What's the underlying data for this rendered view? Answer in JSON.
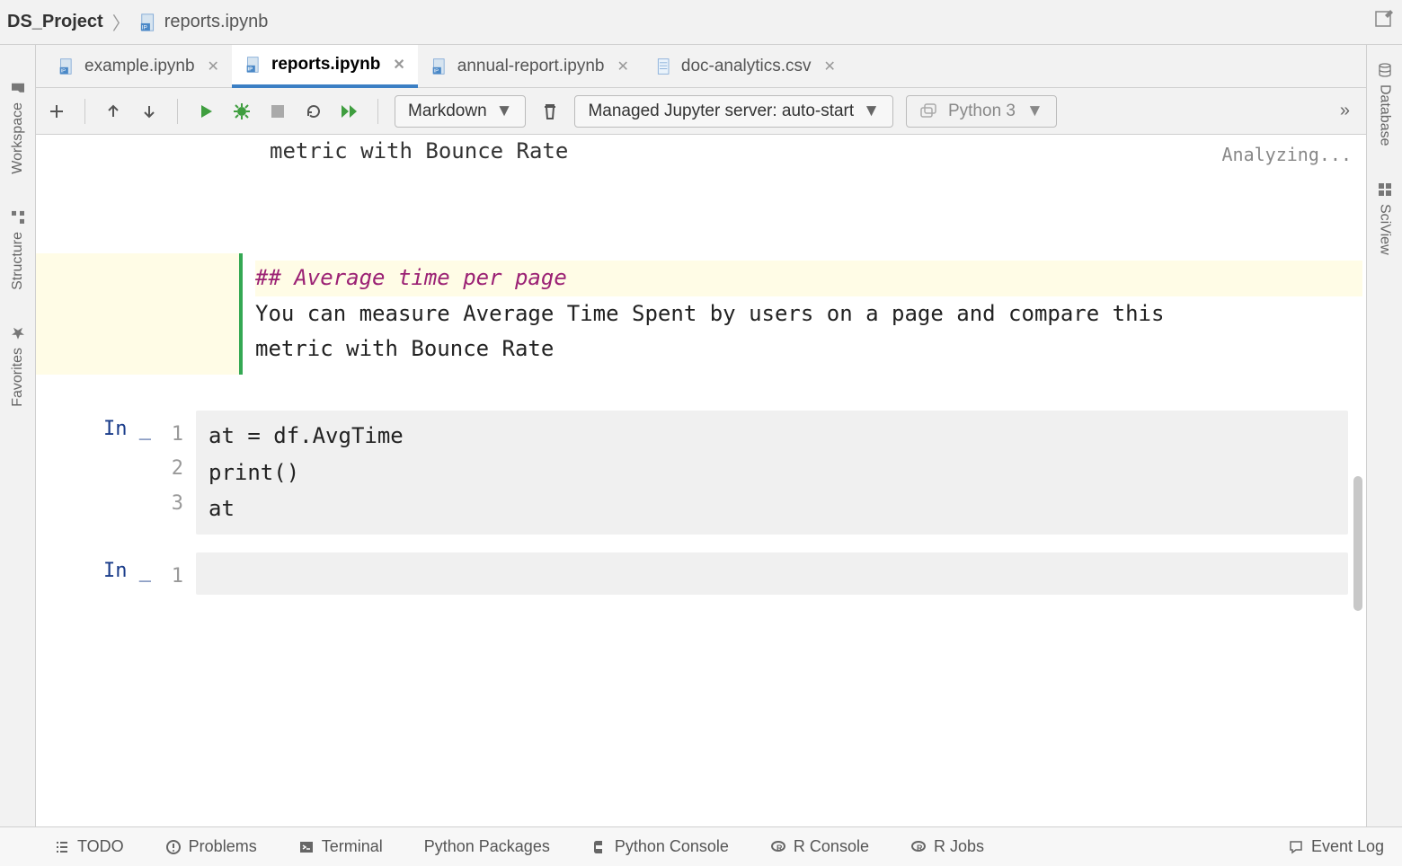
{
  "breadcrumb": {
    "project": "DS_Project",
    "file": "reports.ipynb"
  },
  "tabs": [
    {
      "label": "example.ipynb",
      "active": false,
      "type": "ipynb"
    },
    {
      "label": "reports.ipynb",
      "active": true,
      "type": "ipynb"
    },
    {
      "label": "annual-report.ipynb",
      "active": false,
      "type": "ipynb"
    },
    {
      "label": "doc-analytics.csv",
      "active": false,
      "type": "csv"
    }
  ],
  "toolbar": {
    "celltype": "Markdown",
    "server": "Managed Jupyter server: auto-start",
    "interpreter": "Python 3",
    "overflow": "»"
  },
  "editor": {
    "analyzing": "Analyzing...",
    "md_fragment": "metric with Bounce Rate",
    "md_cell": {
      "heading": "## Average time per page",
      "text_line1": "You can measure Average Time Spent by users on a page and compare this",
      "text_line2": " metric with Bounce Rate"
    },
    "code_cells": [
      {
        "prompt": "In _",
        "lines": [
          "at = df.AvgTime",
          "print()",
          "at"
        ]
      },
      {
        "prompt": "In _",
        "lines": [
          ""
        ]
      }
    ]
  },
  "left_rail": [
    "Workspace",
    "Structure",
    "Favorites"
  ],
  "right_rail": [
    "Database",
    "SciView"
  ],
  "status_bar": [
    "TODO",
    "Problems",
    "Terminal",
    "Python Packages",
    "Python Console",
    "R Console",
    "R Jobs",
    "Event Log"
  ]
}
